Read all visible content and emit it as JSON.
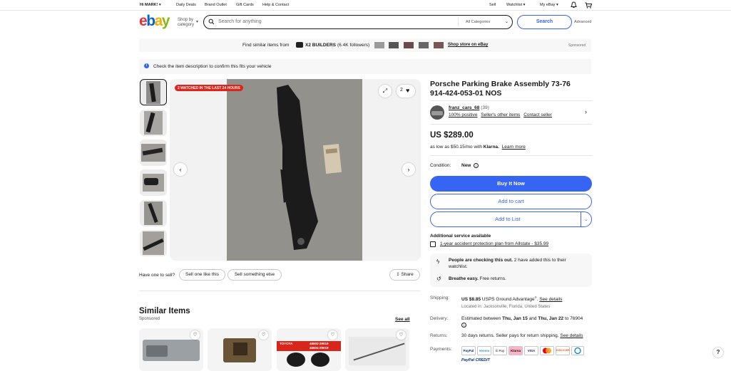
{
  "topbar": {
    "greeting": "Hi MARK!",
    "daily_deals": "Daily Deals",
    "brand_outlet": "Brand Outlet",
    "gift_cards": "Gift Cards",
    "help": "Help & Contact",
    "sell": "Sell",
    "watchlist": "Watchlist",
    "my_ebay": "My eBay"
  },
  "header": {
    "shop_by": "Shop by",
    "category": "category",
    "search_placeholder": "Search for anything",
    "category_select": "All Categories",
    "search_button": "Search",
    "advanced": "Advanced"
  },
  "promo": {
    "text": "Find similar items from",
    "store_name": "X2 BUILDERS",
    "followers": "(6.4K followers)",
    "store_link": "Shop store on eBay",
    "sponsored": "Sponsored"
  },
  "notice": {
    "text": "Check the item description to confirm this fits your vehicle"
  },
  "gallery": {
    "badge": "2 WATCHED IN THE LAST 24 HOURS",
    "watch_count": "2"
  },
  "sell_row": {
    "question": "Have one to sell?",
    "sell_one": "Sell one like this",
    "sell_something": "Sell something else",
    "share": "Share"
  },
  "similar": {
    "title": "Similar Items",
    "sponsored": "Sponsored",
    "see_all": "See all",
    "card3_l1": "TOYOTA",
    "card3_l2": "46502-29019",
    "card3_l3": "46504-29019"
  },
  "product": {
    "title_l1": "Porsche Parking Brake Assembly 73-76",
    "title_l2": "914-424-053-01 NOS"
  },
  "seller": {
    "name": "franz_cars_68",
    "count": "(39)",
    "positive": "100% positive",
    "other_items": "Seller's other items",
    "contact": "Contact seller"
  },
  "price": {
    "main": "US $289.00",
    "installment": "as low as $50.15/mo with",
    "klarna": "Klarna.",
    "learn_more": "Learn more"
  },
  "condition": {
    "label": "Condition:",
    "value": "New"
  },
  "buttons": {
    "buy_now": "Buy It Now",
    "add_cart": "Add to cart",
    "add_list": "Add to List"
  },
  "service": {
    "title": "Additional service available",
    "plan": "1-year accident protection plan from Allstate - $35.99"
  },
  "info": {
    "checking_bold": "People are checking this out.",
    "checking_rest": "2 have added this to their",
    "checking_rest2": "watchlist.",
    "breathe_bold": "Breathe easy.",
    "breathe_rest": "Free returns."
  },
  "shipping": {
    "label": "Shipping:",
    "cost": "US $8.85",
    "method": "USPS Ground Advantage",
    "reg": "®",
    "see_details": "See details",
    "location": "Located in: Jacksonville, Florida, United States"
  },
  "delivery": {
    "label": "Delivery:",
    "pre": "Estimated between",
    "d1": "Thu, Jan 15",
    "and": "and",
    "d2": "Thu, Jan 22",
    "post": "to 76904"
  },
  "returns": {
    "label": "Returns:",
    "text": "30 days returns. Seller pays for return shipping.",
    "see_details": "See details"
  },
  "payments": {
    "label": "Payments:",
    "methods": [
      "PayPal",
      "Venmo",
      "G Pay",
      "Klarna",
      "VISA",
      "MC",
      "DISCOVER",
      "Diners"
    ],
    "credit": "PayPal CREDIT"
  },
  "colors": {
    "accent": "#3665f3",
    "badge": "#e0231b",
    "panel": "#f7f7f7"
  },
  "icons": [
    "chevron-down-icon",
    "bell-icon",
    "cart-icon",
    "search-icon",
    "info-icon",
    "expand-icon",
    "heart-icon",
    "chevron-left-icon",
    "chevron-right-icon",
    "share-icon",
    "lightning-icon",
    "return-icon",
    "help-icon"
  ]
}
